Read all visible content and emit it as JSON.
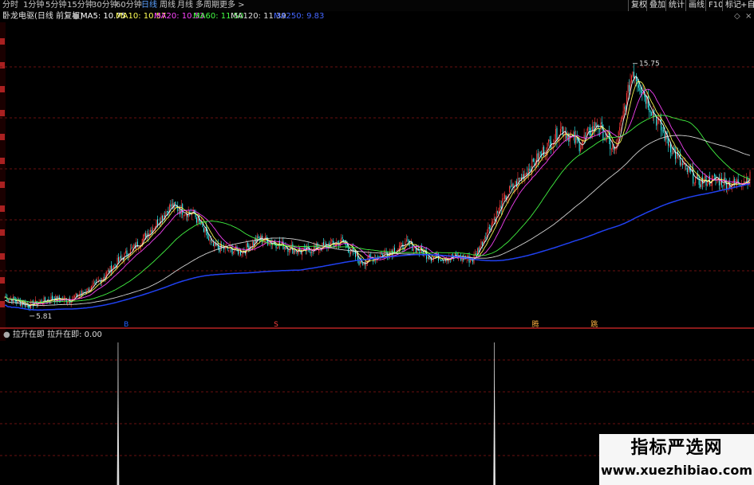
{
  "toolbar": {
    "periods": [
      "分时",
      "1分钟",
      "5分钟",
      "15分钟",
      "30分钟",
      "60分钟",
      "日线",
      "周线",
      "月线",
      "多周期",
      "更多 >"
    ],
    "active_period": "日线",
    "buttons": [
      "复权",
      "叠加",
      "统计",
      "画线",
      "F10",
      "标记",
      "+自"
    ]
  },
  "title": {
    "stock": "卧龙电驱(日线 前复权)",
    "ma": [
      {
        "label": "MA5: 10.75",
        "color": "#ffffff"
      },
      {
        "label": "MA10: 10.57",
        "color": "#ffff55"
      },
      {
        "label": "MA20: 10.53",
        "color": "#ff44ff"
      },
      {
        "label": "MA60: 11.50",
        "color": "#44ff44"
      },
      {
        "label": "MA120: 11.39",
        "color": "#dddddd"
      },
      {
        "label": "MA250: 9.83",
        "color": "#4466ff"
      }
    ]
  },
  "chart_data": {
    "type": "candlestick",
    "price_high_label": "15.75",
    "price_low_label": "5.81",
    "price_range": [
      5.5,
      16.5
    ],
    "keypoints": [
      [
        0,
        6.3
      ],
      [
        20,
        6.0
      ],
      [
        40,
        6.25
      ],
      [
        55,
        6.2
      ],
      [
        75,
        6.7
      ],
      [
        95,
        7.6
      ],
      [
        115,
        8.4
      ],
      [
        140,
        9.7
      ],
      [
        160,
        9.4
      ],
      [
        175,
        8.2
      ],
      [
        200,
        8.0
      ],
      [
        215,
        8.5
      ],
      [
        230,
        8.3
      ],
      [
        250,
        8.0
      ],
      [
        270,
        8.2
      ],
      [
        285,
        8.4
      ],
      [
        300,
        7.6
      ],
      [
        320,
        7.9
      ],
      [
        340,
        8.3
      ],
      [
        360,
        7.8
      ],
      [
        380,
        7.8
      ],
      [
        395,
        7.7
      ],
      [
        410,
        9.0
      ],
      [
        425,
        10.2
      ],
      [
        450,
        11.5
      ],
      [
        470,
        12.6
      ],
      [
        485,
        12.0
      ],
      [
        500,
        12.8
      ],
      [
        515,
        11.7
      ],
      [
        530,
        14.8
      ],
      [
        545,
        13.4
      ],
      [
        555,
        12.5
      ],
      [
        570,
        11.3
      ],
      [
        585,
        10.6
      ],
      [
        600,
        10.7
      ],
      [
        615,
        10.5
      ],
      [
        630,
        10.8
      ]
    ],
    "candle_count": 630,
    "markers": [
      {
        "label": "B",
        "x_frac": 0.163,
        "color": "#2060ff"
      },
      {
        "label": "S",
        "x_frac": 0.364,
        "color": "#ff4040"
      },
      {
        "label": "腾",
        "x_frac": 0.712,
        "color": "#ffb040"
      },
      {
        "label": "跳",
        "x_frac": 0.791,
        "color": "#ffb040"
      }
    ],
    "signal_spikes_x_frac": [
      0.152,
      0.657
    ]
  },
  "sub": {
    "title": "拉升在即",
    "value_label": "拉升在即: 0.00"
  },
  "watermark": {
    "title": "指标严选网",
    "url": "www.xuezhibiao.com"
  }
}
